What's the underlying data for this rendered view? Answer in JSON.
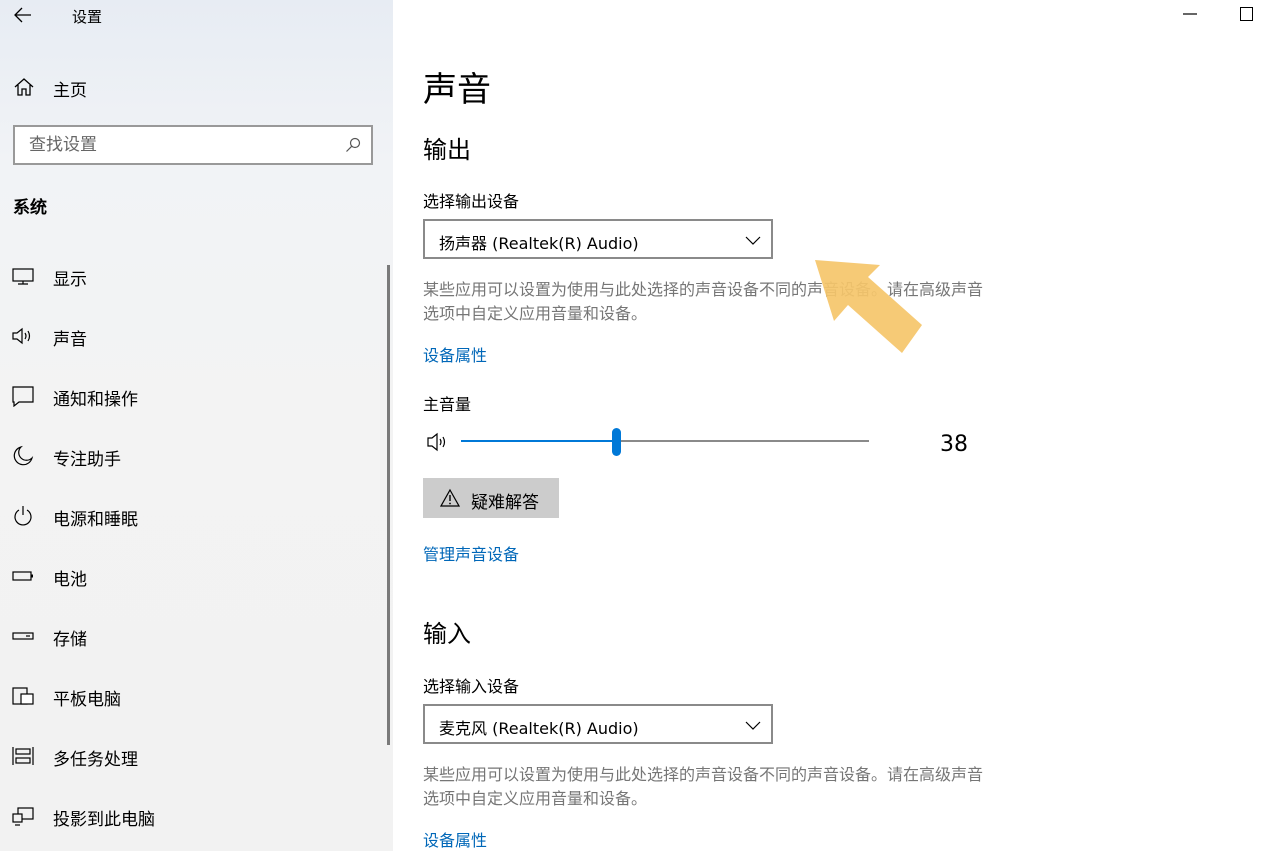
{
  "window": {
    "title": "设置"
  },
  "sidebar": {
    "home_label": "主页",
    "search_placeholder": "查找设置",
    "section_title": "系统",
    "items": [
      {
        "label": "显示",
        "icon": "monitor-icon"
      },
      {
        "label": "声音",
        "icon": "speaker-icon"
      },
      {
        "label": "通知和操作",
        "icon": "notification-icon"
      },
      {
        "label": "专注助手",
        "icon": "moon-icon"
      },
      {
        "label": "电源和睡眠",
        "icon": "power-icon"
      },
      {
        "label": "电池",
        "icon": "battery-icon"
      },
      {
        "label": "存储",
        "icon": "storage-icon"
      },
      {
        "label": "平板电脑",
        "icon": "tablet-icon"
      },
      {
        "label": "多任务处理",
        "icon": "multitask-icon"
      },
      {
        "label": "投影到此电脑",
        "icon": "project-icon"
      }
    ]
  },
  "main": {
    "page_title": "声音",
    "output": {
      "heading": "输出",
      "select_label": "选择输出设备",
      "device": "扬声器 (Realtek(R) Audio)",
      "description": "某些应用可以设置为使用与此处选择的声音设备不同的声音设备。请在高级声音选项中自定义应用音量和设备。",
      "properties_link": "设备属性",
      "volume_label": "主音量",
      "volume": 38,
      "volume_display": "38",
      "troubleshoot_label": "疑难解答",
      "manage_link": "管理声音设备"
    },
    "input": {
      "heading": "输入",
      "select_label": "选择输入设备",
      "device": "麦克风 (Realtek(R) Audio)",
      "description": "某些应用可以设置为使用与此处选择的声音设备不同的声音设备。请在高级声音选项中自定义应用音量和设备。",
      "properties_link": "设备属性"
    }
  },
  "colors": {
    "accent": "#0078d7",
    "link": "#0067b8",
    "annotation_arrow": "#f5c56a"
  }
}
